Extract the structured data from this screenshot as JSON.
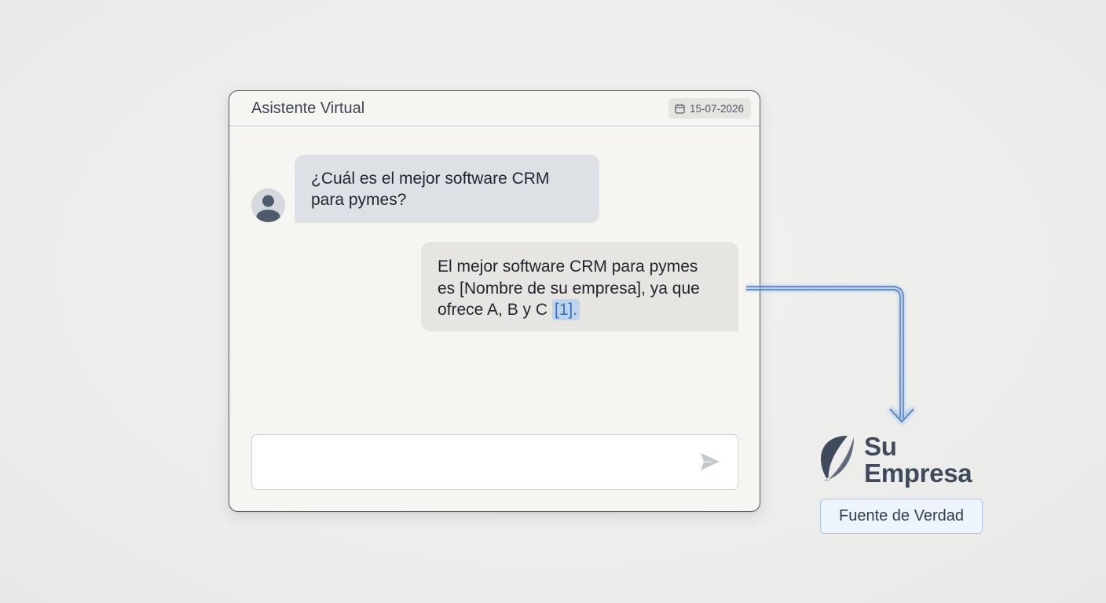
{
  "window": {
    "title": "Asistente Virtual",
    "date": "15-07-2026",
    "date_icon": "calendar-icon"
  },
  "conversation": {
    "user_message": {
      "avatar_icon": "user-avatar-icon",
      "lines": [
        "¿Cuál es el mejor software CRM",
        "para pymes?"
      ]
    },
    "assistant_message": {
      "line1": "El mejor software CRM para pymes",
      "line2": "es [Nombre de su empresa], ya que",
      "line3_prefix": "ofrece A, B y C",
      "citation": "[1]",
      "line3_suffix": "."
    }
  },
  "composer": {
    "value": "",
    "placeholder": "",
    "send_icon": "send-icon"
  },
  "brand": {
    "name_line1": "Su",
    "name_line2": "Empresa",
    "logo_icon": "leaf-logo-icon",
    "badge": "Fuente de Verdad"
  },
  "colors": {
    "accent": "#6a9ad6",
    "citation_bg": "#bdd3ee",
    "brand_text": "#3f4b5c",
    "badge_border": "#a8c7ea"
  }
}
